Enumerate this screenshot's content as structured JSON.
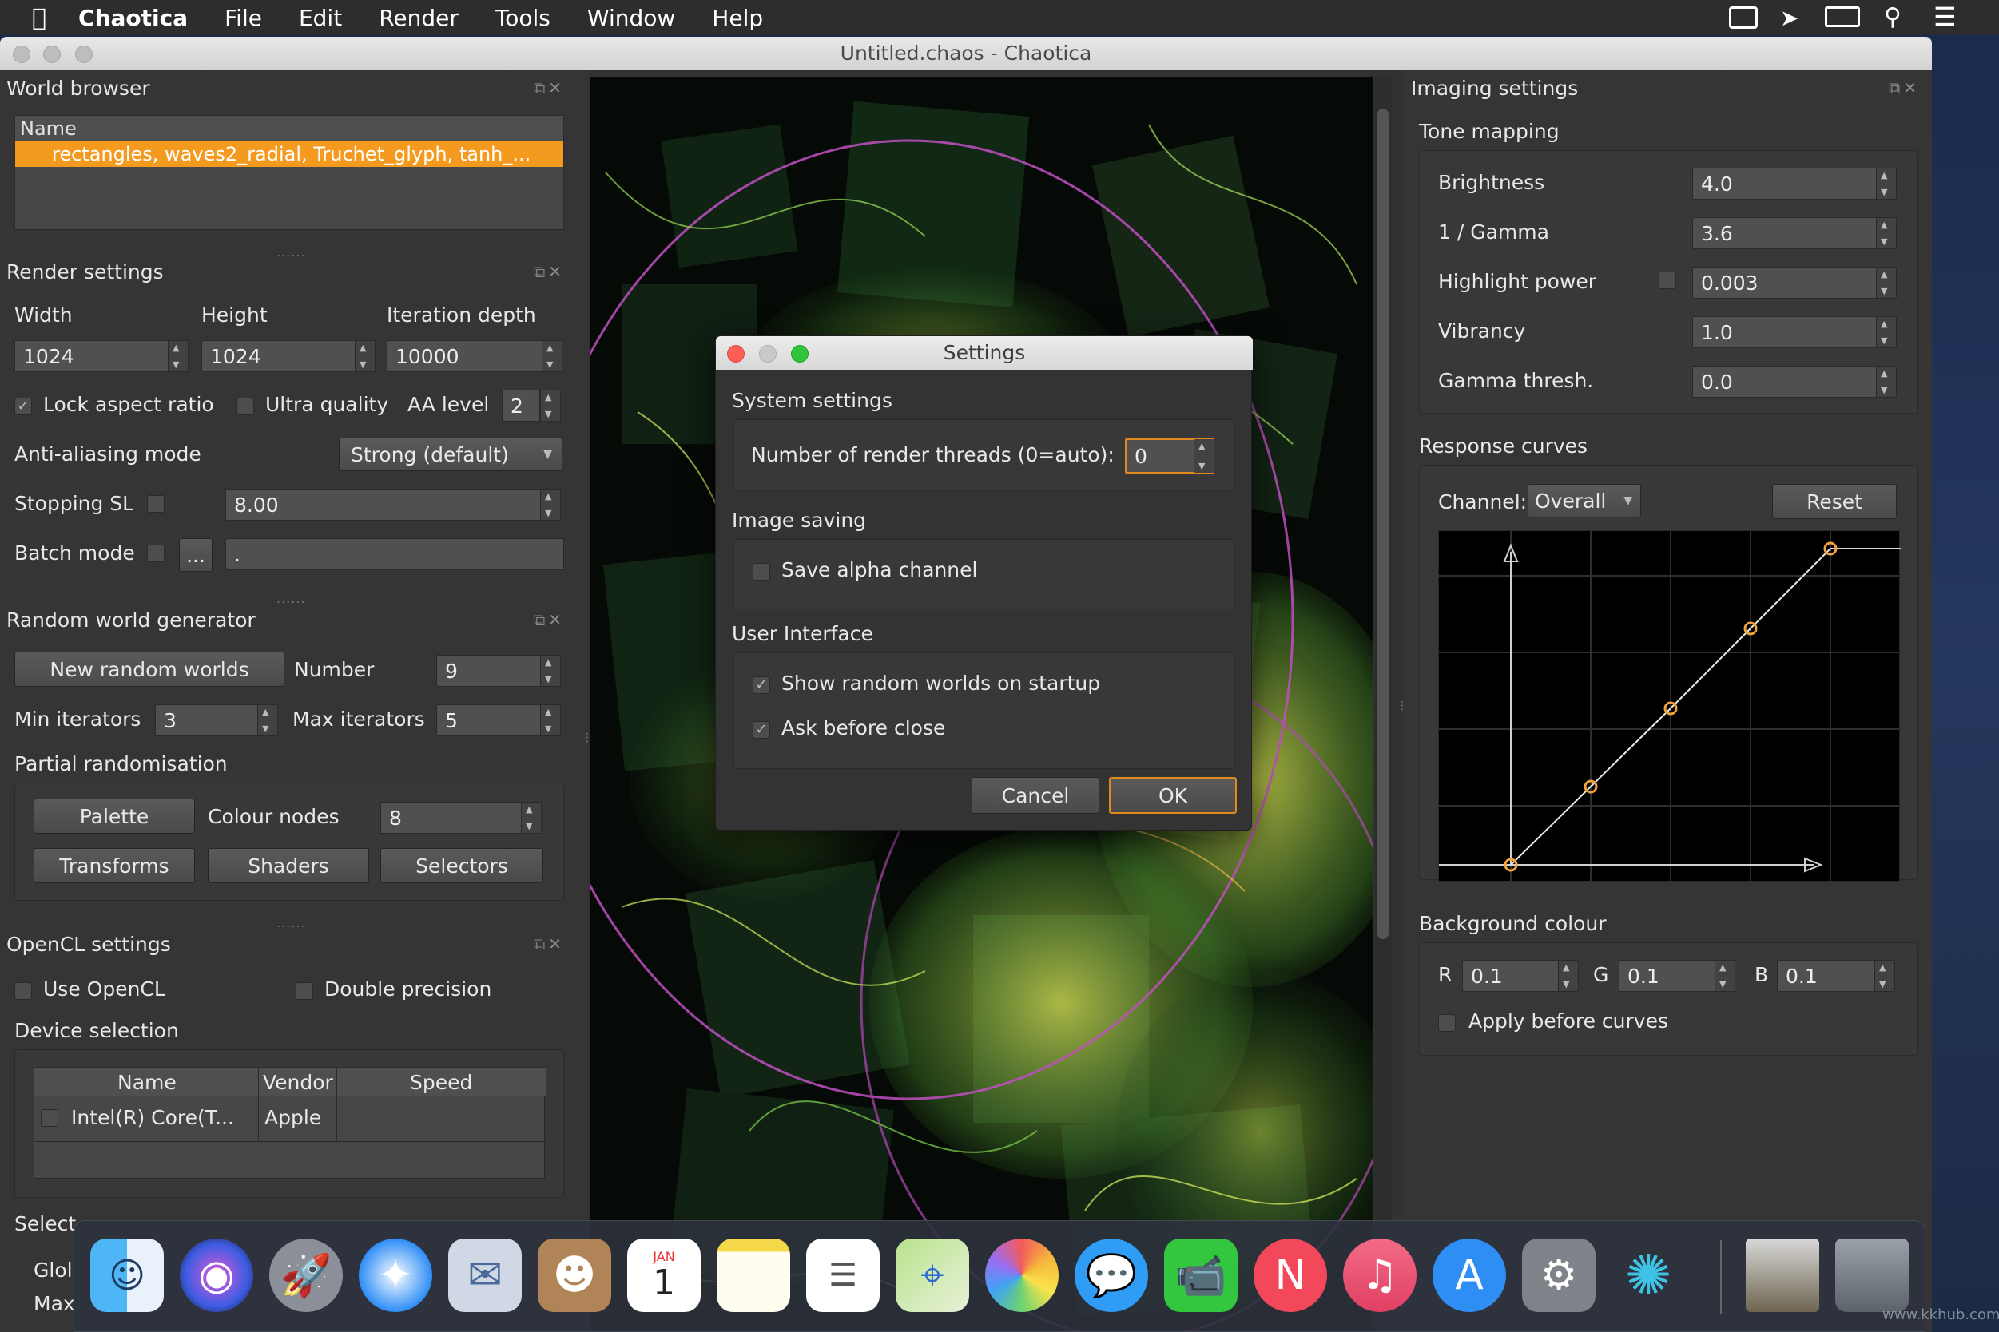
{
  "menubar": {
    "apple": "",
    "app_name": "Chaotica",
    "items": [
      "File",
      "Edit",
      "Render",
      "Tools",
      "Window",
      "Help"
    ],
    "status_icons": [
      "notification-icon",
      "cursor-icon",
      "screen-mirroring-icon",
      "spotlight-search-icon",
      "control-center-icon"
    ]
  },
  "window": {
    "title": "Untitled.chaos - Chaotica"
  },
  "world_browser": {
    "title": "World browser",
    "column": "Name",
    "selected_row": "rectangles, waves2_radial, Truchet_glyph, tanh_..."
  },
  "render_settings": {
    "title": "Render settings",
    "width_label": "Width",
    "height_label": "Height",
    "depth_label": "Iteration depth",
    "width": "1024",
    "height": "1024",
    "depth": "10000",
    "lock_aspect": "Lock aspect ratio",
    "ultra_quality": "Ultra quality",
    "aa_level_label": "AA level",
    "aa_level": "2",
    "aa_mode_label": "Anti-aliasing mode",
    "aa_mode": "Strong (default)",
    "stopping_sl_label": "Stopping SL",
    "stopping_sl": "8.00",
    "batch_mode_label": "Batch mode",
    "batch_browse": "...",
    "batch_path": "."
  },
  "random_world": {
    "title": "Random world generator",
    "new_button": "New random worlds",
    "number_label": "Number",
    "number": "9",
    "min_label": "Min iterators",
    "min": "3",
    "max_label": "Max iterators",
    "max": "5",
    "partial_label": "Partial randomisation",
    "palette": "Palette",
    "colour_nodes_label": "Colour nodes",
    "colour_nodes": "8",
    "transforms": "Transforms",
    "shaders": "Shaders",
    "selectors": "Selectors"
  },
  "opencl": {
    "title": "OpenCL settings",
    "use_opencl": "Use OpenCL",
    "double_precision": "Double precision",
    "device_selection": "Device selection",
    "columns": [
      "Name",
      "Vendor",
      "Speed"
    ],
    "device_name": "Intel(R) Core(T...",
    "device_vendor": "Apple",
    "select_label": "Select",
    "glob_label": "Glol",
    "max_label": "Max"
  },
  "imaging": {
    "title": "Imaging settings",
    "tone_mapping": "Tone mapping",
    "brightness_label": "Brightness",
    "brightness": "4.0",
    "gamma_label": "1 / Gamma",
    "gamma": "3.6",
    "highlight_label": "Highlight power",
    "highlight": "0.003",
    "vibrancy_label": "Vibrancy",
    "vibrancy": "1.0",
    "gamma_thresh_label": "Gamma thresh.",
    "gamma_thresh": "0.0",
    "response_curves": "Response curves",
    "channel_label": "Channel:",
    "channel": "Overall",
    "reset": "Reset",
    "background_colour": "Background colour",
    "r_label": "R",
    "r": "0.1",
    "g_label": "G",
    "g": "0.1",
    "b_label": "B",
    "b": "0.1",
    "apply_before_curves": "Apply before curves"
  },
  "dialog": {
    "title": "Settings",
    "system": "System settings",
    "threads_label": "Number of render threads (0=auto):",
    "threads": "0",
    "image_saving": "Image saving",
    "save_alpha": "Save alpha channel",
    "user_interface": "User Interface",
    "show_random": "Show random worlds on startup",
    "ask_close": "Ask before close",
    "cancel": "Cancel",
    "ok": "OK"
  },
  "dock": {
    "calendar_month": "JAN",
    "calendar_day": "1",
    "apps": [
      "Finder",
      "Siri",
      "Launchpad",
      "Safari",
      "Mail",
      "Contacts",
      "Calendar",
      "Notes",
      "Reminders",
      "Maps",
      "Photos",
      "Messages",
      "FaceTime",
      "News",
      "Music",
      "App Store",
      "System Preferences",
      "Chaotica",
      "Downloads",
      "Trash"
    ]
  },
  "watermark": "www.kkhub.com",
  "colors": {
    "selection": "#f39a1f",
    "ok_border": "#e08a1e",
    "curve": "#f1a13a",
    "accent_green": "#30c43c"
  }
}
